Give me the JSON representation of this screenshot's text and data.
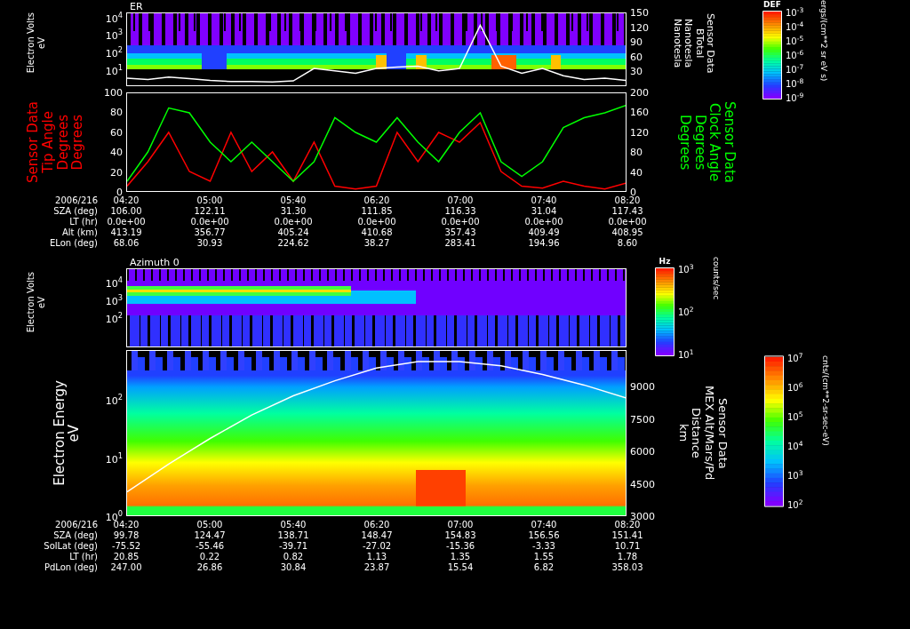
{
  "panels": [
    {
      "kind": "fieldspectrum",
      "title": "ER",
      "left_label": [
        "Electron Volts",
        "eV"
      ],
      "left_ticks": [
        "10$^{4}$",
        "10$^{3}$",
        "10$^{2}$",
        "10$^{1}$"
      ],
      "right_label": [
        "Sensor Data",
        "BTotal",
        "Nanotesla",
        "Nanotesla"
      ],
      "colorbar": {
        "title": "DEF",
        "ticks": [
          "10$^{-3}$",
          "10$^{-4}$",
          "10$^{-5}$",
          "10$^{-6}$",
          "10$^{-7}$",
          "10$^{-8}$",
          "10$^{-9}$"
        ],
        "units": "ergs/(cm**2 sr eV s)"
      },
      "chart_data": {
        "type": "line",
        "ylim": [
          0,
          150
        ],
        "yticks": [
          {
            "value": 30,
            "label": "30"
          },
          {
            "value": 60,
            "label": "60"
          },
          {
            "value": 90,
            "label": "90"
          },
          {
            "value": 120,
            "label": "120"
          },
          {
            "value": 150,
            "label": "150"
          }
        ],
        "series": [
          {
            "color": "#ffffff",
            "values": [
              15,
              12,
              17,
              14,
              10,
              8,
              8,
              7,
              9,
              35,
              30,
              25,
              35,
              38,
              40,
              30,
              35,
              125,
              40,
              25,
              35,
              20,
              12,
              15,
              10
            ]
          }
        ]
      }
    },
    {
      "kind": "anglechart",
      "left_label": [
        "Sensor Data",
        "Tip Angle",
        "Degrees",
        "Degrees"
      ],
      "right_label": [
        "Sensor Data",
        "Clock Angle",
        "Degrees",
        "Degrees"
      ],
      "chart_data": {
        "type": "line",
        "categories": [
          "04:20",
          null,
          null,
          null,
          "05:00",
          null,
          null,
          null,
          "05:40",
          null,
          null,
          null,
          "06:20",
          null,
          null,
          null,
          "07:00",
          null,
          null,
          null,
          "07:40",
          null,
          null,
          null,
          "08:20"
        ],
        "ylim": [
          0,
          100
        ],
        "y2lim": [
          0,
          200
        ],
        "yticks": [
          {
            "value": 0,
            "label": "0"
          },
          {
            "value": 20,
            "label": "20"
          },
          {
            "value": 40,
            "label": "40"
          },
          {
            "value": 60,
            "label": "60"
          },
          {
            "value": 80,
            "label": "80"
          },
          {
            "value": 100,
            "label": "100"
          }
        ],
        "y2ticks": [
          {
            "value": 0,
            "label": "0"
          },
          {
            "value": 40,
            "label": "40"
          },
          {
            "value": 80,
            "label": "80"
          },
          {
            "value": 120,
            "label": "120"
          },
          {
            "value": 160,
            "label": "160"
          },
          {
            "value": 200,
            "label": "200"
          }
        ],
        "series": [
          {
            "color": "#ff0000",
            "values": [
              5,
              30,
              60,
              20,
              10,
              60,
              20,
              40,
              10,
              50,
              5,
              2,
              5,
              60,
              30,
              60,
              50,
              70,
              20,
              5,
              3,
              10,
              5,
              2,
              8
            ]
          },
          {
            "color": "#00ff00",
            "axis": "y2",
            "values": [
              20,
              80,
              170,
              160,
              100,
              60,
              100,
              60,
              20,
              60,
              150,
              120,
              100,
              150,
              100,
              60,
              120,
              160,
              60,
              30,
              60,
              130,
              150,
              160,
              175
            ]
          }
        ]
      }
    }
  ],
  "ephemeris_top": {
    "date": "2006/216",
    "rows": [
      {
        "label": "SZA (deg)",
        "values": [
          "106.00",
          "122.11",
          "31.30",
          "111.85",
          "116.33",
          "31.04",
          "117.43"
        ]
      },
      {
        "label": "LT (hr)",
        "values": [
          "0.0e+00",
          "0.0e+00",
          "0.0e+00",
          "0.0e+00",
          "0.0e+00",
          "0.0e+00",
          "0.0e+00"
        ]
      },
      {
        "label": "Alt (km)",
        "values": [
          "413.19",
          "356.77",
          "405.24",
          "410.68",
          "357.43",
          "409.49",
          "408.95"
        ]
      },
      {
        "label": "ELon (deg)",
        "values": [
          "68.06",
          "30.93",
          "224.62",
          "38.27",
          "283.41",
          "194.96",
          "8.60"
        ]
      }
    ]
  },
  "lower_panels": [
    {
      "kind": "countspectrum",
      "title": "Azimuth 0",
      "left_label": [
        "Electron Volts",
        "eV"
      ],
      "left_ticks": [
        "10$^{4}$",
        "10$^{3}$",
        "10$^{2}$"
      ],
      "colorbar": {
        "title": "Hz",
        "ticks": [
          "10$^{3}$",
          "10$^{2}$",
          "10$^{1}$"
        ],
        "units": "counts/sec"
      }
    },
    {
      "kind": "fluxspectrum",
      "left_label": [
        "Electron Energy",
        "eV"
      ],
      "left_ticks": [
        "10$^{2}$",
        "10$^{1}$",
        "10$^{0}$"
      ],
      "right_label": [
        "Sensor Data",
        "MEX Alt/Mars/Pd",
        "Distance",
        "km"
      ],
      "colorbar": {
        "ticks": [
          "10$^{7}$",
          "10$^{6}$",
          "10$^{5}$",
          "10$^{4}$",
          "10$^{3}$",
          "10$^{2}$"
        ],
        "units": "cnts/(cm**2-sr-sec-eV)"
      },
      "chart_data": {
        "type": "line",
        "categories": [
          "04:20",
          null,
          "05:00",
          null,
          "05:40",
          null,
          "06:20",
          null,
          "07:00",
          null,
          "07:40",
          null,
          "08:20"
        ],
        "ylim": [
          3000,
          10700
        ],
        "yticks": [
          {
            "value": 3000,
            "label": "3000"
          },
          {
            "value": 4500,
            "label": "4500"
          },
          {
            "value": 6000,
            "label": "6000"
          },
          {
            "value": 7500,
            "label": "7500"
          },
          {
            "value": 9000,
            "label": "9000"
          }
        ],
        "series": [
          {
            "color": "#ffffff",
            "values": [
              4100,
              5400,
              6600,
              7700,
              8600,
              9300,
              9900,
              10200,
              10200,
              10000,
              9600,
              9100,
              8500
            ]
          }
        ]
      }
    }
  ],
  "ephemeris_bottom": {
    "date": "2006/216",
    "rows": [
      {
        "label": "SZA (deg)",
        "values": [
          "99.78",
          "124.47",
          "138.71",
          "148.47",
          "154.83",
          "156.56",
          "151.41"
        ]
      },
      {
        "label": "SolLat (deg)",
        "values": [
          "-75.52",
          "-55.46",
          "-39.71",
          "-27.02",
          "-15.36",
          "-3.33",
          "10.71"
        ]
      },
      {
        "label": "LT (hr)",
        "values": [
          "20.85",
          "0.22",
          "0.82",
          "1.13",
          "1.35",
          "1.55",
          "1.78"
        ]
      },
      {
        "label": "PdLon (deg)",
        "values": [
          "247.00",
          "26.86",
          "30.84",
          "23.87",
          "15.54",
          "6.82",
          "358.03"
        ]
      }
    ]
  }
}
